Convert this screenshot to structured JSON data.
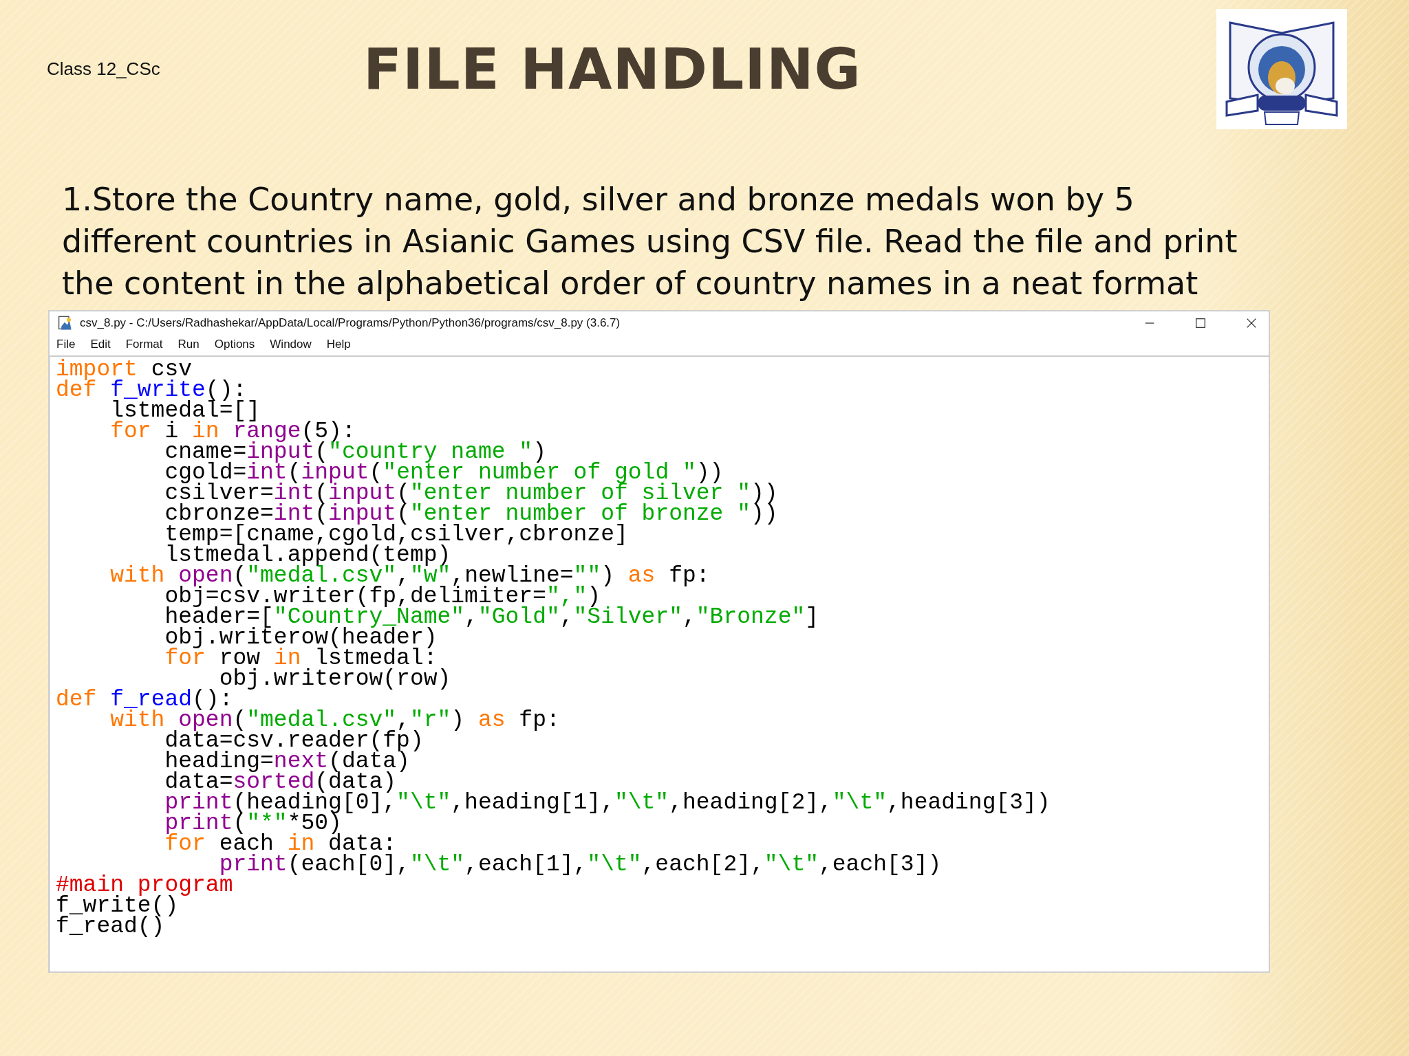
{
  "slide": {
    "class_label": "Class 12_CSc",
    "title": "FILE HANDLING",
    "question": "1.Store the Country name, gold, silver and bronze medals won by 5 different countries in Asianic Games using CSV file. Read the file and print the content in the alphabetical order of country names in a neat format"
  },
  "window": {
    "title": "csv_8.py - C:/Users/Radhashekar/AppData/Local/Programs/Python/Python36/programs/csv_8.py (3.6.7)",
    "menu": [
      "File",
      "Edit",
      "Format",
      "Run",
      "Options",
      "Window",
      "Help"
    ],
    "code": [
      [
        {
          "kind": "keyword",
          "text": "import"
        },
        {
          "kind": "plain",
          "text": " csv"
        }
      ],
      [
        {
          "kind": "keyword",
          "text": "def "
        },
        {
          "kind": "defname",
          "text": "f_write"
        },
        {
          "kind": "plain",
          "text": "():"
        }
      ],
      [
        {
          "kind": "plain",
          "text": "    lstmedal=[]"
        }
      ],
      [
        {
          "kind": "keyword",
          "text": "    for"
        },
        {
          "kind": "plain",
          "text": " i "
        },
        {
          "kind": "keyword",
          "text": "in "
        },
        {
          "kind": "builtin",
          "text": "range"
        },
        {
          "kind": "plain",
          "text": "(5):"
        }
      ],
      [
        {
          "kind": "plain",
          "text": "        cname="
        },
        {
          "kind": "builtin",
          "text": "input"
        },
        {
          "kind": "plain",
          "text": "("
        },
        {
          "kind": "string",
          "text": "\"country name \""
        },
        {
          "kind": "plain",
          "text": ")"
        }
      ],
      [
        {
          "kind": "plain",
          "text": "        cgold="
        },
        {
          "kind": "builtin",
          "text": "int"
        },
        {
          "kind": "plain",
          "text": "("
        },
        {
          "kind": "builtin",
          "text": "input"
        },
        {
          "kind": "plain",
          "text": "("
        },
        {
          "kind": "string",
          "text": "\"enter number of gold \""
        },
        {
          "kind": "plain",
          "text": "))"
        }
      ],
      [
        {
          "kind": "plain",
          "text": "        csilver="
        },
        {
          "kind": "builtin",
          "text": "int"
        },
        {
          "kind": "plain",
          "text": "("
        },
        {
          "kind": "builtin",
          "text": "input"
        },
        {
          "kind": "plain",
          "text": "("
        },
        {
          "kind": "string",
          "text": "\"enter number of silver \""
        },
        {
          "kind": "plain",
          "text": "))"
        }
      ],
      [
        {
          "kind": "plain",
          "text": "        cbronze="
        },
        {
          "kind": "builtin",
          "text": "int"
        },
        {
          "kind": "plain",
          "text": "("
        },
        {
          "kind": "builtin",
          "text": "input"
        },
        {
          "kind": "plain",
          "text": "("
        },
        {
          "kind": "string",
          "text": "\"enter number of bronze \""
        },
        {
          "kind": "plain",
          "text": "))"
        }
      ],
      [
        {
          "kind": "plain",
          "text": "        temp=[cname,cgold,csilver,cbronze]"
        }
      ],
      [
        {
          "kind": "plain",
          "text": "        lstmedal.append(temp)"
        }
      ],
      [
        {
          "kind": "keyword",
          "text": "    with "
        },
        {
          "kind": "builtin",
          "text": "open"
        },
        {
          "kind": "plain",
          "text": "("
        },
        {
          "kind": "string",
          "text": "\"medal.csv\""
        },
        {
          "kind": "plain",
          "text": ","
        },
        {
          "kind": "string",
          "text": "\"w\""
        },
        {
          "kind": "plain",
          "text": ",newline="
        },
        {
          "kind": "string",
          "text": "\"\""
        },
        {
          "kind": "plain",
          "text": ") "
        },
        {
          "kind": "keyword",
          "text": "as"
        },
        {
          "kind": "plain",
          "text": " fp:"
        }
      ],
      [
        {
          "kind": "plain",
          "text": "        obj=csv.writer(fp,delimiter="
        },
        {
          "kind": "string",
          "text": "\",\""
        },
        {
          "kind": "plain",
          "text": ")"
        }
      ],
      [
        {
          "kind": "plain",
          "text": "        header=["
        },
        {
          "kind": "string",
          "text": "\"Country_Name\""
        },
        {
          "kind": "plain",
          "text": ","
        },
        {
          "kind": "string",
          "text": "\"Gold\""
        },
        {
          "kind": "plain",
          "text": ","
        },
        {
          "kind": "string",
          "text": "\"Silver\""
        },
        {
          "kind": "plain",
          "text": ","
        },
        {
          "kind": "string",
          "text": "\"Bronze\""
        },
        {
          "kind": "plain",
          "text": "]"
        }
      ],
      [
        {
          "kind": "plain",
          "text": "        obj.writerow(header)"
        }
      ],
      [
        {
          "kind": "keyword",
          "text": "        for"
        },
        {
          "kind": "plain",
          "text": " row "
        },
        {
          "kind": "keyword",
          "text": "in"
        },
        {
          "kind": "plain",
          "text": " lstmedal:"
        }
      ],
      [
        {
          "kind": "plain",
          "text": "            obj.writerow(row)"
        }
      ],
      [
        {
          "kind": "keyword",
          "text": "def "
        },
        {
          "kind": "defname",
          "text": "f_read"
        },
        {
          "kind": "plain",
          "text": "():"
        }
      ],
      [
        {
          "kind": "keyword",
          "text": "    with "
        },
        {
          "kind": "builtin",
          "text": "open"
        },
        {
          "kind": "plain",
          "text": "("
        },
        {
          "kind": "string",
          "text": "\"medal.csv\""
        },
        {
          "kind": "plain",
          "text": ","
        },
        {
          "kind": "string",
          "text": "\"r\""
        },
        {
          "kind": "plain",
          "text": ") "
        },
        {
          "kind": "keyword",
          "text": "as"
        },
        {
          "kind": "plain",
          "text": " fp:"
        }
      ],
      [
        {
          "kind": "plain",
          "text": "        data=csv.reader(fp)"
        }
      ],
      [
        {
          "kind": "plain",
          "text": "        heading="
        },
        {
          "kind": "builtin",
          "text": "next"
        },
        {
          "kind": "plain",
          "text": "(data)"
        }
      ],
      [
        {
          "kind": "plain",
          "text": "        data="
        },
        {
          "kind": "builtin",
          "text": "sorted"
        },
        {
          "kind": "plain",
          "text": "(data)"
        }
      ],
      [
        {
          "kind": "builtin",
          "text": "        print"
        },
        {
          "kind": "plain",
          "text": "(heading[0],"
        },
        {
          "kind": "string",
          "text": "\"\\t\""
        },
        {
          "kind": "plain",
          "text": ",heading[1],"
        },
        {
          "kind": "string",
          "text": "\"\\t\""
        },
        {
          "kind": "plain",
          "text": ",heading[2],"
        },
        {
          "kind": "string",
          "text": "\"\\t\""
        },
        {
          "kind": "plain",
          "text": ",heading[3])"
        }
      ],
      [
        {
          "kind": "builtin",
          "text": "        print"
        },
        {
          "kind": "plain",
          "text": "("
        },
        {
          "kind": "string",
          "text": "\"*\""
        },
        {
          "kind": "plain",
          "text": "*50)"
        }
      ],
      [
        {
          "kind": "keyword",
          "text": "        for"
        },
        {
          "kind": "plain",
          "text": " each "
        },
        {
          "kind": "keyword",
          "text": "in"
        },
        {
          "kind": "plain",
          "text": " data:"
        }
      ],
      [
        {
          "kind": "builtin",
          "text": "            print"
        },
        {
          "kind": "plain",
          "text": "(each[0],"
        },
        {
          "kind": "string",
          "text": "\"\\t\""
        },
        {
          "kind": "plain",
          "text": ",each[1],"
        },
        {
          "kind": "string",
          "text": "\"\\t\""
        },
        {
          "kind": "plain",
          "text": ",each[2],"
        },
        {
          "kind": "string",
          "text": "\"\\t\""
        },
        {
          "kind": "plain",
          "text": ",each[3])"
        }
      ],
      [
        {
          "kind": "comment",
          "text": "#main program"
        }
      ],
      [
        {
          "kind": "plain",
          "text": "f_write()"
        }
      ],
      [
        {
          "kind": "plain",
          "text": "f_read()"
        }
      ]
    ]
  }
}
